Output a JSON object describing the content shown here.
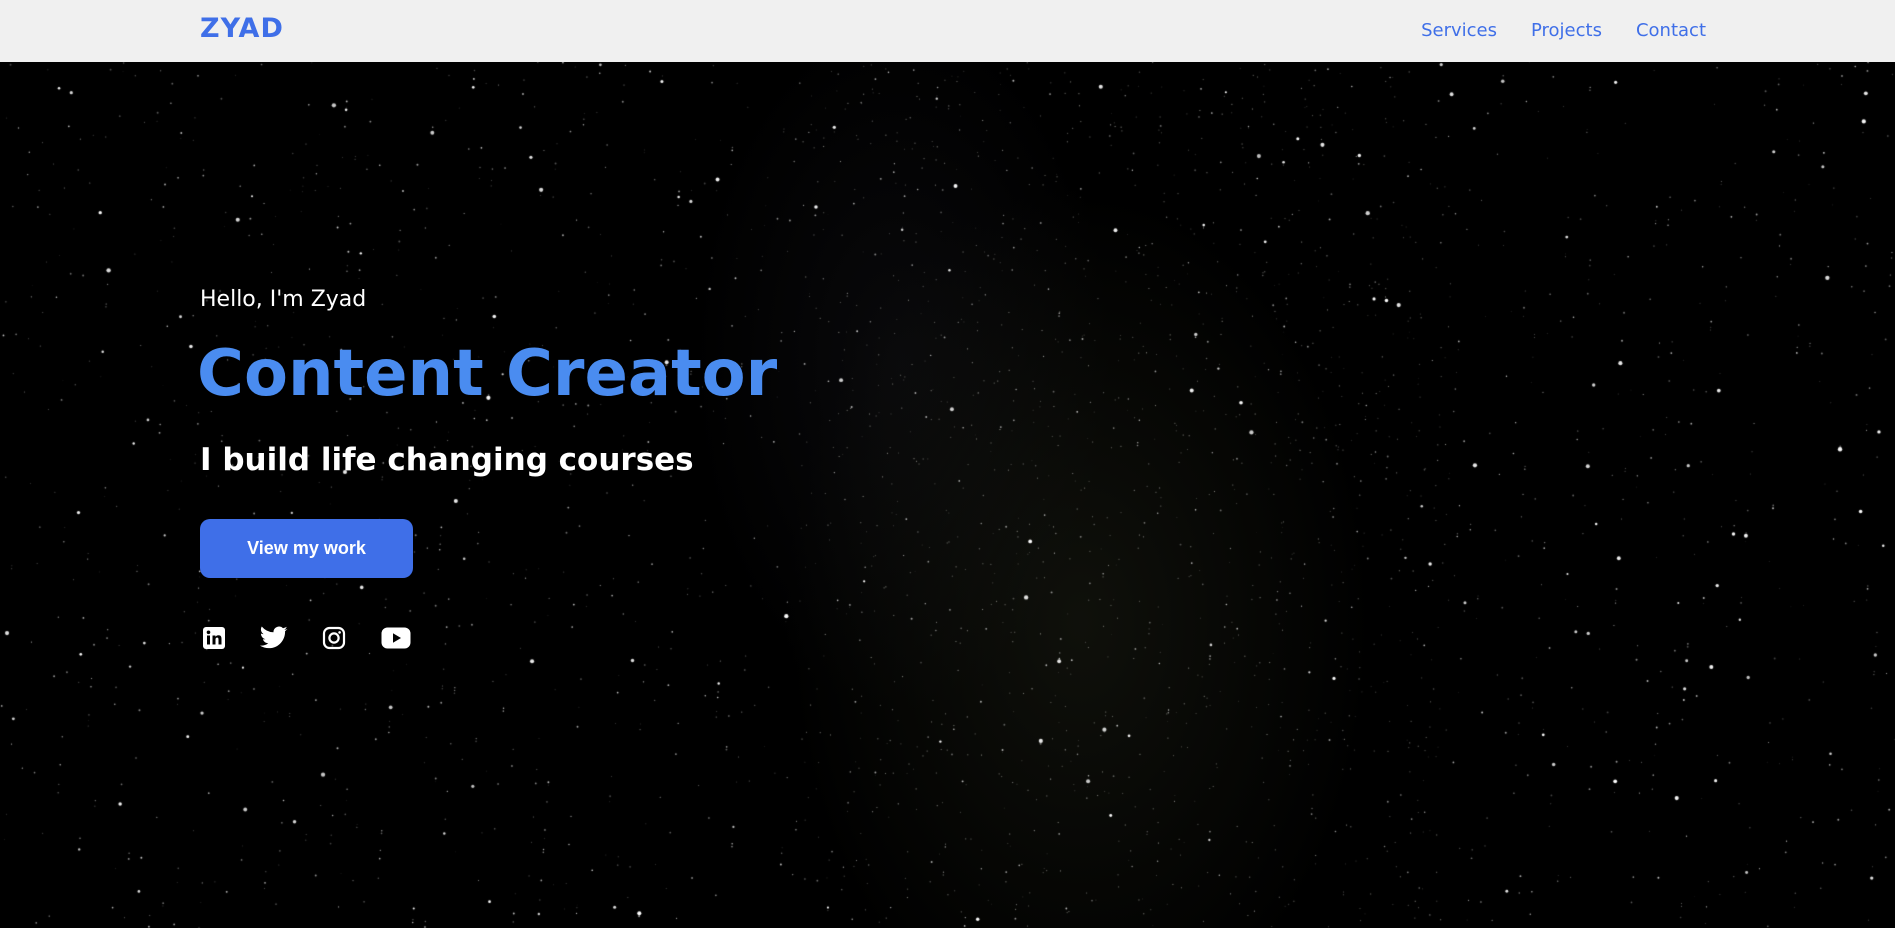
{
  "navbar": {
    "logo": "ZYAD",
    "links": [
      "Services",
      "Projects",
      "Contact"
    ]
  },
  "hero": {
    "greeting": "Hello, I'm Zyad",
    "headline": "Content Creator",
    "tagline": "I build life changing courses",
    "cta_label": "View my work",
    "socials": [
      "linkedin-icon",
      "twitter-icon",
      "instagram-icon",
      "youtube-icon"
    ]
  },
  "colors": {
    "accent": "#3f6fe8",
    "headline": "#4a8cf0",
    "navbar_bg": "#f0f0f0",
    "hero_bg": "#000000"
  }
}
